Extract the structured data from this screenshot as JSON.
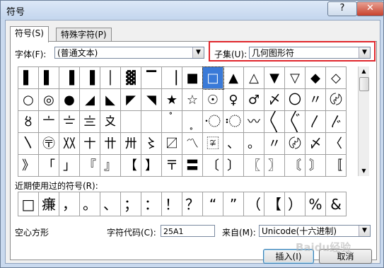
{
  "window": {
    "title": "符号",
    "help": "?",
    "close": "✕"
  },
  "tabs": [
    {
      "label": "符号(S)"
    },
    {
      "label": "特殊字符(P)"
    }
  ],
  "font": {
    "label": "字体(F):",
    "value": "(普通文本)"
  },
  "subset": {
    "label": "子集(U):",
    "value": "几何图形符"
  },
  "grid_rows": [
    [
      "▌",
      "▌",
      "▐",
      "▐",
      "│",
      "▓",
      "▔",
      "▕",
      "■",
      "□",
      "▲",
      "△",
      "▼",
      "▽",
      "◆",
      "◇"
    ],
    [
      "○",
      "◎",
      "●",
      "◢",
      "◣",
      "◤",
      "◥",
      "★",
      "☆",
      "☉",
      "♀",
      "♂",
      "〆",
      "〇",
      "〃",
      "〄"
    ],
    [
      "〥",
      "〦",
      "〧",
      "〨",
      "〩",
      "〪",
      "〫",
      "〬",
      "〭",
      "〮",
      "〯",
      "〰",
      "〱",
      "〲",
      "〳",
      "〴"
    ],
    [
      "〵",
      "〶",
      "〷",
      "〸",
      "〹",
      "〺",
      "〻",
      "〼",
      "〽",
      "〾",
      "、",
      "。",
      "〃",
      "〄",
      "〆",
      "〈"
    ],
    [
      "》",
      "「",
      "」",
      "『",
      "』",
      "【",
      "】",
      "〒",
      "〓",
      "〔",
      "〕",
      "〖",
      "〗",
      "〘",
      "〙",
      "〚"
    ]
  ],
  "selected_cell": {
    "row": 0,
    "col": 9
  },
  "recent": {
    "label": "近期使用过的符号(R):",
    "symbols": [
      "□",
      "㾾",
      "，",
      "。",
      "、",
      "；",
      "：",
      "！",
      "？",
      "“",
      "”",
      "（",
      "【",
      "）",
      "%",
      "&"
    ]
  },
  "char_name": "空心方形",
  "char_code": {
    "label": "字符代码(C):",
    "value": "25A1"
  },
  "from": {
    "label": "来自(M):",
    "value": "Unicode(十六进制)"
  },
  "buttons": {
    "insert": "插入(I)",
    "cancel": "取消"
  },
  "watermark": "Baidu经验"
}
